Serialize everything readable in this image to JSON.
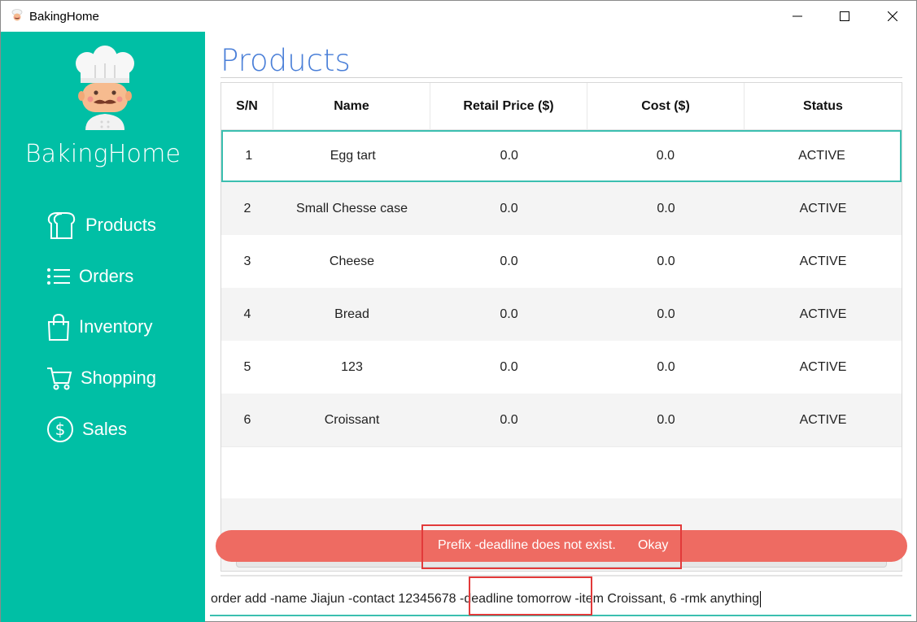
{
  "window": {
    "title": "BakingHome",
    "controls": [
      "minimize",
      "maximize",
      "close"
    ]
  },
  "sidebar": {
    "brand": "BakingHome",
    "logo": "chef-icon",
    "bg_color": "#00bfa5",
    "items": [
      {
        "label": "Products",
        "icon": "bread-icon"
      },
      {
        "label": "Orders",
        "icon": "list-icon"
      },
      {
        "label": "Inventory",
        "icon": "bag-icon"
      },
      {
        "label": "Shopping",
        "icon": "cart-icon"
      },
      {
        "label": "Sales",
        "icon": "dollar-icon"
      }
    ]
  },
  "main": {
    "title": "Products",
    "title_color": "#4a7fd8"
  },
  "table": {
    "headers": [
      "S/N",
      "Name",
      "Retail Price ($)",
      "Cost ($)",
      "Status"
    ],
    "rows": [
      {
        "sn": "1",
        "name": "Egg tart",
        "price": "0.0",
        "cost": "0.0",
        "status": "ACTIVE"
      },
      {
        "sn": "2",
        "name": "Small Chesse case",
        "price": "0.0",
        "cost": "0.0",
        "status": "ACTIVE"
      },
      {
        "sn": "3",
        "name": "Cheese",
        "price": "0.0",
        "cost": "0.0",
        "status": "ACTIVE"
      },
      {
        "sn": "4",
        "name": "Bread",
        "price": "0.0",
        "cost": "0.0",
        "status": "ACTIVE"
      },
      {
        "sn": "5",
        "name": "123",
        "price": "0.0",
        "cost": "0.0",
        "status": "ACTIVE"
      },
      {
        "sn": "6",
        "name": "Croissant",
        "price": "0.0",
        "cost": "0.0",
        "status": "ACTIVE"
      }
    ],
    "selected_row": 1
  },
  "toast": {
    "message": "Prefix -deadline does not exist.",
    "button": "Okay",
    "color": "#ee6b62"
  },
  "command": {
    "before": "order add -name Jiajun -contact 12345678 ",
    "highlighted": "-deadline tomorrow",
    "after": " -item Croissant, 6 -rmk anything"
  },
  "highlight_color": "#e23a3a"
}
